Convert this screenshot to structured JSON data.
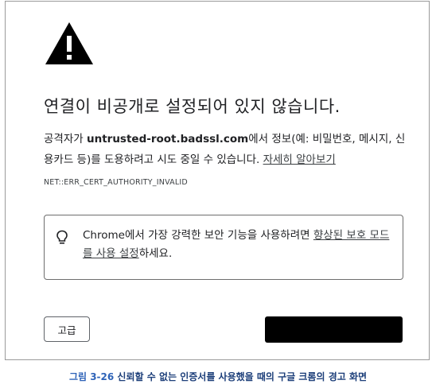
{
  "page": {
    "title": "연결이 비공개로 설정되어 있지 않습니다.",
    "desc_prefix": "공격자가 ",
    "desc_domain": "untrusted-root.badssl.com",
    "desc_suffix": "에서 정보(예: 비밀번호, 메시지, 신용카드 등)를 도용하려고 시도 중일 수 있습니다. ",
    "learn_more": "자세히 알아보기",
    "error_code": "NET::ERR_CERT_AUTHORITY_INVALID",
    "promo_prefix": "Chrome에서 가장 강력한 보안 기능을 사용하려면 ",
    "promo_link": "향상된 보호 모드를 사용 설정",
    "promo_suffix": "하세요.",
    "advanced_label": "고급",
    "back_label": ""
  },
  "caption": {
    "number": "그림 3-26",
    "text": " 신뢰할 수 없는 인증서를 사용했을 때의 구글 크롬의 경고 화면"
  },
  "icons": {
    "warning": "warning-triangle-icon",
    "promo": "lightbulb-icon"
  },
  "colors": {
    "text": "#202124",
    "caption_number": "#2e63b8",
    "caption_text": "#1d3f7a",
    "back_button": "#000000"
  }
}
